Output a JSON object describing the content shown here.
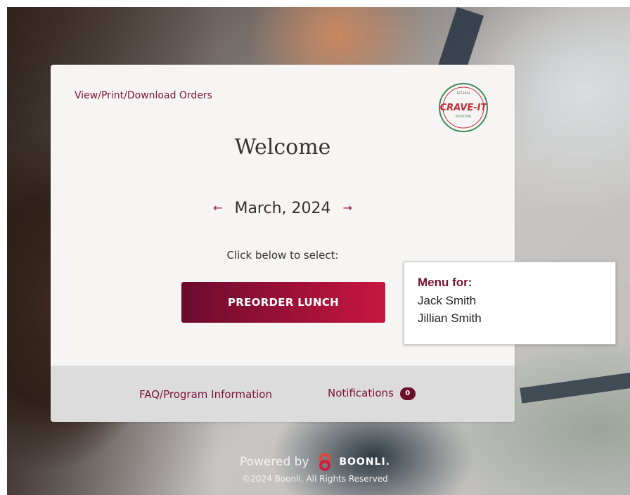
{
  "links": {
    "view_print": "View/Print/Download Orders",
    "faq": "FAQ/Program Information",
    "notifications": "Notifications"
  },
  "notifications_count": "0",
  "logo": {
    "top_text": "EST.2014",
    "main_text": "CRAVE-IT",
    "bottom_text": "NUTRITION"
  },
  "welcome": "Welcome",
  "calendar": {
    "prev_icon": "←",
    "month": "March, 2024",
    "next_icon": "→"
  },
  "instruction": "Click below to select:",
  "preorder_label": "PREORDER LUNCH",
  "menu": {
    "title": "Menu for:",
    "names": [
      "Jack Smith",
      "Jillian Smith"
    ]
  },
  "footer": {
    "powered_by": "Powered by",
    "brand": "BOONLI.",
    "copyright": "©2024 Boonli, All Rights Reserved"
  },
  "colors": {
    "accent": "#7d1238",
    "button_start": "#6a0b2e",
    "button_end": "#c8163f"
  }
}
